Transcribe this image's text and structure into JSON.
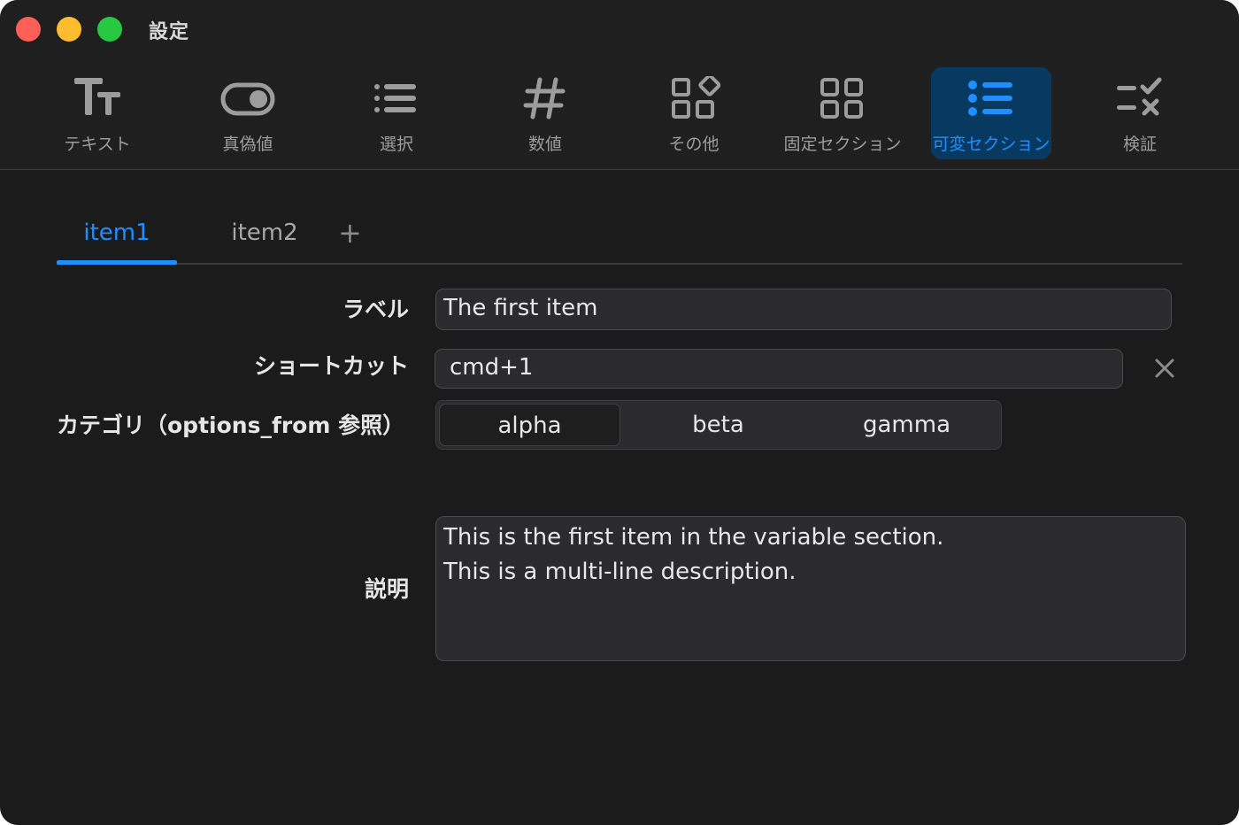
{
  "window": {
    "title": "設定"
  },
  "toolbar": {
    "items": [
      {
        "label": "テキスト",
        "icon": "text-size-icon",
        "active": false
      },
      {
        "label": "真偽値",
        "icon": "toggle-icon",
        "active": false
      },
      {
        "label": "選択",
        "icon": "list-bullet-icon",
        "active": false
      },
      {
        "label": "数値",
        "icon": "number-sign-icon",
        "active": false
      },
      {
        "label": "その他",
        "icon": "apps-shapes-icon",
        "active": false
      },
      {
        "label": "固定セクション",
        "icon": "grid-icon",
        "active": false
      },
      {
        "label": "可変セクション",
        "icon": "list-icon",
        "active": true
      },
      {
        "label": "検証",
        "icon": "checklist-icon",
        "active": false
      }
    ],
    "accent_color": "#1f8fff"
  },
  "tabs": {
    "items": [
      {
        "label": "item1",
        "active": true
      },
      {
        "label": "item2",
        "active": false
      }
    ],
    "add_label": "+"
  },
  "form": {
    "label_field": {
      "label": "ラベル",
      "value": "The first item"
    },
    "shortcut_field": {
      "label": "ショートカット",
      "value": "cmd+1",
      "clear_icon": "close-icon"
    },
    "category_field": {
      "label": "カテゴリ（options_from 参照）",
      "options": [
        "alpha",
        "beta",
        "gamma"
      ],
      "selected": "alpha"
    },
    "description_field": {
      "label": "説明",
      "lines": [
        "This is the first item in the variable section.",
        "This is a multi-line description."
      ]
    }
  }
}
